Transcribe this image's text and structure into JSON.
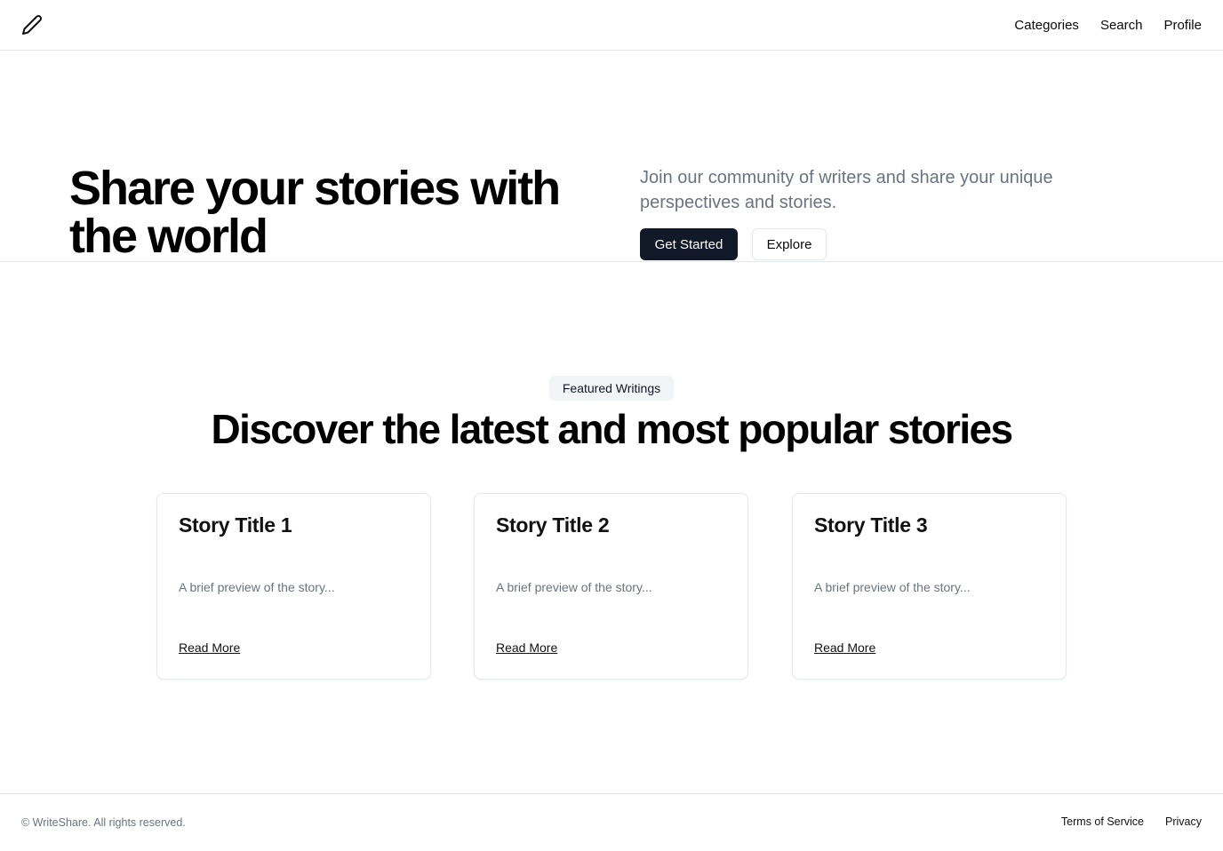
{
  "header": {
    "logo_icon": "pencil-icon",
    "nav": [
      {
        "label": "Categories"
      },
      {
        "label": "Search"
      },
      {
        "label": "Profile"
      }
    ]
  },
  "hero": {
    "title": "Share your stories with the world",
    "description": "Join our community of writers and share your unique perspectives and stories.",
    "primary_button": "Get Started",
    "secondary_button": "Explore"
  },
  "featured": {
    "badge": "Featured Writings",
    "title": "Discover the latest and most popular stories",
    "cards": [
      {
        "title": "Story Title 1",
        "preview": "A brief preview of the story...",
        "link": "Read More"
      },
      {
        "title": "Story Title 2",
        "preview": "A brief preview of the story...",
        "link": "Read More"
      },
      {
        "title": "Story Title 3",
        "preview": "A brief preview of the story...",
        "link": "Read More"
      }
    ]
  },
  "footer": {
    "copyright": "© WriteShare. All rights reserved.",
    "links": [
      {
        "label": "Terms of Service"
      },
      {
        "label": "Privacy"
      }
    ]
  },
  "colors": {
    "primary_button": "#111827",
    "muted_text": "#6b7280",
    "border": "#e5e7eb",
    "badge_bg": "#f3f4f6"
  }
}
